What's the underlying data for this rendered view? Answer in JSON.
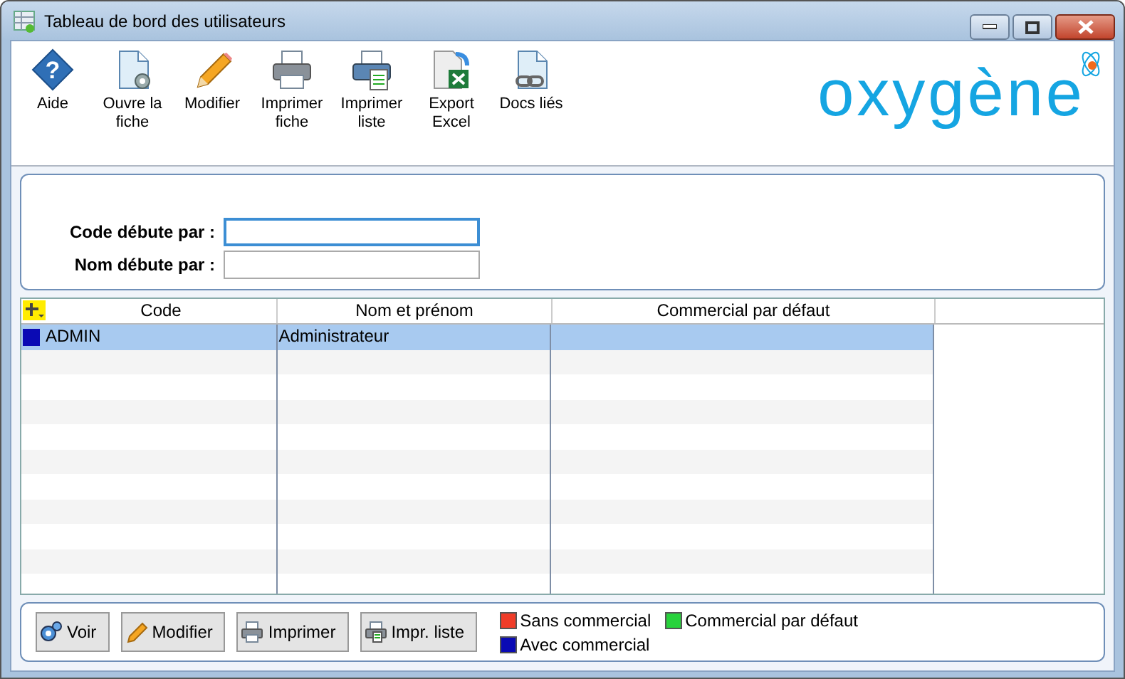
{
  "window": {
    "title": "Tableau de bord des utilisateurs"
  },
  "toolbar": [
    {
      "label": "Aide",
      "kind": "help",
      "glyph": "?"
    },
    {
      "label": "Ouvre la fiche",
      "kind": "open"
    },
    {
      "label": "Modifier",
      "kind": "edit"
    },
    {
      "label": "Imprimer fiche",
      "kind": "print"
    },
    {
      "label": "Imprimer liste",
      "kind": "printlist"
    },
    {
      "label": "Export Excel",
      "kind": "excel"
    },
    {
      "label": "Docs liés",
      "kind": "docs"
    }
  ],
  "logo": "oxygène",
  "filters": [
    {
      "label": "Code débute par :",
      "focused": true
    },
    {
      "label": "Nom débute par :",
      "focused": false
    }
  ],
  "table": {
    "columns": [
      "Code",
      "Nom et prénom",
      "Commercial par défaut"
    ],
    "rows": [
      {
        "code": "ADMIN",
        "name": "Administrateur",
        "color": "#0a0ab4",
        "selected": true
      }
    ]
  },
  "buttons": [
    {
      "label": "Voir",
      "kind": "view"
    },
    {
      "label": "Modifier",
      "kind": "edit"
    },
    {
      "label": "Imprimer",
      "kind": "print"
    },
    {
      "label": "Impr. liste",
      "kind": "printlist"
    }
  ],
  "legend": [
    {
      "label": "Sans commercial",
      "color": "#f03c28"
    },
    {
      "label": "Commercial par défaut",
      "color": "#28d23c"
    },
    {
      "label": "Avec commercial",
      "color": "#0a0ab4"
    }
  ]
}
